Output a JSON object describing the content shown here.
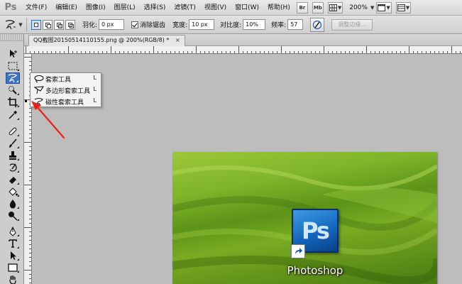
{
  "app": {
    "logo": "Ps"
  },
  "menu": {
    "items": [
      "文件(F)",
      "编辑(E)",
      "图像(I)",
      "图层(L)",
      "选择(S)",
      "滤镜(T)",
      "视图(V)",
      "窗口(W)",
      "帮助(H)"
    ],
    "br_label": "Br",
    "mb_label": "Mb",
    "zoom": "200%"
  },
  "options": {
    "feather_label": "羽化:",
    "feather_value": "0 px",
    "antialias_label": "消除锯齿",
    "width_label": "宽度:",
    "width_value": "10 px",
    "contrast_label": "对比度:",
    "contrast_value": "10%",
    "frequency_label": "频率:",
    "frequency_value": "57",
    "refine_label": "调整边缘..."
  },
  "document": {
    "tab_title": "QQ截图20150514110155.png @ 200%(RGB/8) *",
    "close": "×"
  },
  "flyout": {
    "items": [
      {
        "label": "套索工具",
        "key": "L"
      },
      {
        "label": "多边形套索工具",
        "key": "L"
      },
      {
        "label": "磁性套索工具",
        "key": "L"
      }
    ]
  },
  "desktop_icon": {
    "icon_text": "Ps",
    "label": "Photoshop"
  },
  "colors": {
    "arrow": "#e8211b",
    "accent": "#3e73c6"
  }
}
